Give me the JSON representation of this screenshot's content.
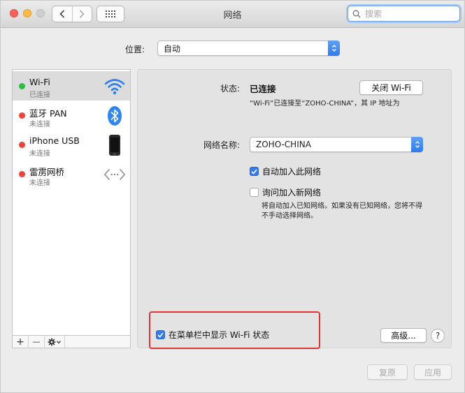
{
  "window": {
    "title": "网络"
  },
  "search": {
    "placeholder": "搜索"
  },
  "location": {
    "label": "位置:",
    "value": "自动"
  },
  "services": [
    {
      "name": "Wi-Fi",
      "status": "已连接",
      "dot_color": "#2bbf3c",
      "icon": "wifi-icon"
    },
    {
      "name": "蓝牙 PAN",
      "status": "未连接",
      "dot_color": "#f2403c",
      "icon": "bluetooth-icon"
    },
    {
      "name": "iPhone USB",
      "status": "未连接",
      "dot_color": "#f2403c",
      "icon": "iphone-icon"
    },
    {
      "name": "雷雳网桥",
      "status": "未连接",
      "dot_color": "#f2403c",
      "icon": "thunderbolt-bridge-icon"
    }
  ],
  "sidebar_toolbar": {
    "add": "+",
    "remove": "—"
  },
  "detail": {
    "status_label": "状态:",
    "status_value": "已连接",
    "turn_off_button": "关闭 Wi-Fi",
    "status_description": "“Wi-Fi”已连接至“ZOHO-CHINA”，其 IP 地址为",
    "network_name_label": "网络名称:",
    "network_name_value": "ZOHO-CHINA",
    "auto_join_label": "自动加入此网络",
    "auto_join_checked": true,
    "ask_join_label": "询问加入新网络",
    "ask_join_checked": false,
    "ask_join_note": "将自动加入已知网络。如果没有已知网络，您将不得不手动选择网络。",
    "show_menu_bar_label": "在菜单栏中显示 Wi-Fi 状态",
    "show_menu_bar_checked": true,
    "advanced_button": "高级...",
    "help_button": "?"
  },
  "footer": {
    "revert_button": "复原",
    "apply_button": "应用"
  },
  "colors": {
    "accent": "#2f7cf6",
    "highlight": "#e23232"
  }
}
